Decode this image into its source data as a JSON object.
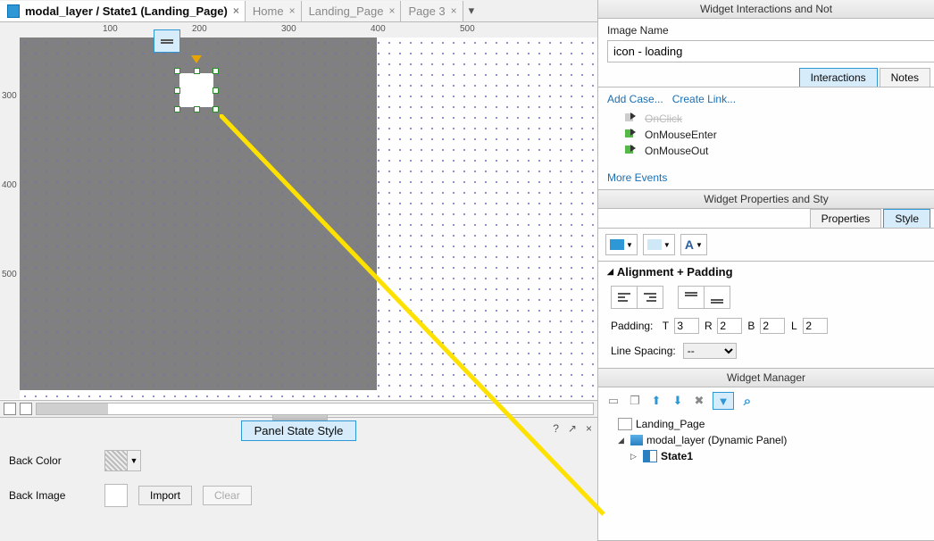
{
  "tabs": {
    "items": [
      {
        "label": "modal_layer / State1 (Landing_Page)",
        "active": true,
        "icon": true
      },
      {
        "label": "Home",
        "active": false
      },
      {
        "label": "Landing_Page",
        "active": false
      },
      {
        "label": "Page 3",
        "active": false
      }
    ]
  },
  "ruler_h": [
    "100",
    "200",
    "300",
    "400",
    "500"
  ],
  "ruler_v": [
    "300",
    "400",
    "500"
  ],
  "panel_state_style": {
    "title": "Panel State Style",
    "back_color_label": "Back Color",
    "back_image_label": "Back Image",
    "import_label": "Import",
    "clear_label": "Clear"
  },
  "interactions_pane": {
    "title": "Widget Interactions and Not",
    "image_name_label": "Image Name",
    "image_name_value": "icon - loading",
    "tabs": {
      "interactions": "Interactions",
      "notes": "Notes",
      "active": "interactions"
    },
    "add_case": "Add Case...",
    "create_link": "Create Link...",
    "events": [
      {
        "label": "OnClick",
        "dim": true
      },
      {
        "label": "OnMouseEnter",
        "dim": false
      },
      {
        "label": "OnMouseOut",
        "dim": false
      }
    ],
    "more_events": "More Events"
  },
  "properties_pane": {
    "title": "Widget Properties and Sty",
    "tabs": {
      "properties": "Properties",
      "style": "Style",
      "active": "style"
    },
    "section": "Alignment + Padding",
    "padding_label": "Padding:",
    "pad": {
      "T": "3",
      "R": "2",
      "B": "2",
      "L": "2"
    },
    "line_spacing_label": "Line Spacing:",
    "line_spacing_value": "--"
  },
  "widget_manager": {
    "title": "Widget Manager",
    "nodes": {
      "page": "Landing_Page",
      "panel": "modal_layer (Dynamic Panel)",
      "state": "State1"
    }
  },
  "chart_data": null
}
